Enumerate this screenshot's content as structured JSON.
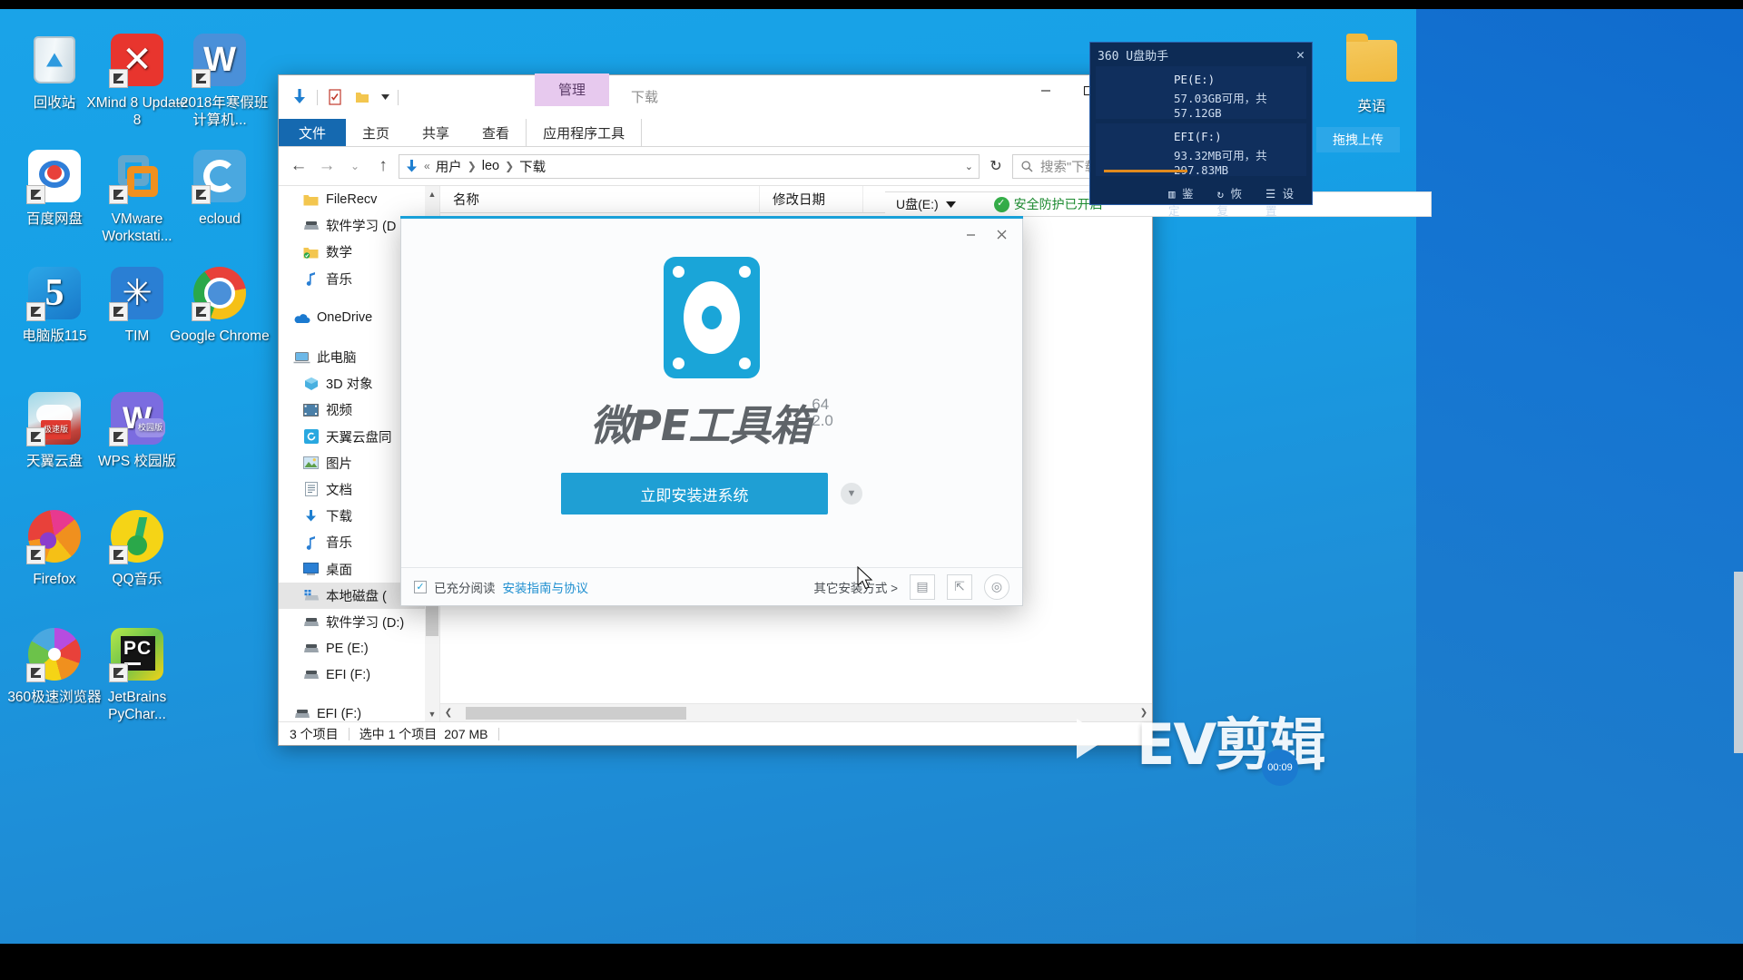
{
  "desktop": {
    "icons": [
      {
        "label": "回收站",
        "icon": "recycle-bin-icon",
        "shortcut": false,
        "col": 0,
        "row": 0
      },
      {
        "label": "XMind 8 Update 8",
        "icon": "xmind-icon",
        "shortcut": true,
        "col": 1,
        "row": 0
      },
      {
        "label": "--2018年寒假班计算机...",
        "icon": "word-doc-icon",
        "shortcut": true,
        "col": 2,
        "row": 0
      },
      {
        "label": "百度网盘",
        "icon": "baidu-netdisk-icon",
        "shortcut": true,
        "col": 0,
        "row": 1
      },
      {
        "label": "VMware Workstati...",
        "icon": "vmware-icon",
        "shortcut": true,
        "col": 1,
        "row": 1
      },
      {
        "label": "ecloud",
        "icon": "ecloud-icon",
        "shortcut": true,
        "col": 2,
        "row": 1
      },
      {
        "label": "电脑版115",
        "icon": "115-icon",
        "shortcut": true,
        "col": 0,
        "row": 2
      },
      {
        "label": "TIM",
        "icon": "tim-icon",
        "shortcut": true,
        "col": 1,
        "row": 2
      },
      {
        "label": "Google Chrome",
        "icon": "chrome-icon",
        "shortcut": true,
        "col": 2,
        "row": 2
      },
      {
        "label": "天翼云盘",
        "icon": "tianyi-cloud-icon",
        "shortcut": true,
        "col": 0,
        "row": 3,
        "badge": "极速版"
      },
      {
        "label": "WPS 校园版",
        "icon": "wps-icon",
        "shortcut": true,
        "col": 1,
        "row": 3,
        "badge": "校园版"
      },
      {
        "label": "Firefox",
        "icon": "firefox-icon",
        "shortcut": true,
        "col": 0,
        "row": 4
      },
      {
        "label": "QQ音乐",
        "icon": "qq-music-icon",
        "shortcut": true,
        "col": 1,
        "row": 4
      },
      {
        "label": "360极速浏览器",
        "icon": "360-browser-icon",
        "shortcut": true,
        "col": 0,
        "row": 5
      },
      {
        "label": "JetBrains PyChar...",
        "icon": "pycharm-icon",
        "shortcut": true,
        "col": 1,
        "row": 5
      }
    ],
    "right_icon": {
      "label": "英语",
      "icon": "folder-icon"
    }
  },
  "explorer": {
    "quick_access": {
      "download_icon": "download-arrow-icon",
      "properties_icon": "properties-icon",
      "new_folder_icon": "new-folder-icon",
      "customize_icon": "chevron-down-icon"
    },
    "context_tab_group": "管理",
    "window_title": "下载",
    "window_buttons": {
      "minimize": "minimize-icon",
      "maximize": "maximize-icon",
      "close": "close-icon"
    },
    "ribbon_tabs": [
      {
        "label": "文件",
        "active": true
      },
      {
        "label": "主页",
        "active": false
      },
      {
        "label": "共享",
        "active": false
      },
      {
        "label": "查看",
        "active": false
      },
      {
        "label": "应用程序工具",
        "active": false
      }
    ],
    "ribbon_right": {
      "collapse_icon": "chevron-down-icon",
      "help_label": "?"
    },
    "address": {
      "back_icon": "arrow-left-icon",
      "forward_icon": "arrow-right-icon",
      "recent_icon": "chevron-down-icon",
      "up_icon": "arrow-up-icon",
      "path_icon": "download-arrow-icon",
      "crumbs": [
        "用户",
        "leo",
        "下载"
      ],
      "prefix": "«",
      "dropdown_icon": "chevron-down-icon",
      "refresh_icon": "refresh-icon"
    },
    "search": {
      "placeholder": "搜索\"下载\"",
      "icon": "search-icon"
    },
    "sidebar": [
      {
        "label": "FileRecv",
        "icon": "folder-icon",
        "indent": 2
      },
      {
        "label": "软件学习 (D",
        "icon": "drive-icon",
        "indent": 2
      },
      {
        "label": "数学",
        "icon": "folder-sync-icon",
        "indent": 2
      },
      {
        "label": "音乐",
        "icon": "music-note-icon",
        "indent": 2
      },
      {
        "type": "gap"
      },
      {
        "label": "OneDrive",
        "icon": "onedrive-icon",
        "indent": 1
      },
      {
        "type": "gap"
      },
      {
        "label": "此电脑",
        "icon": "this-pc-icon",
        "indent": 1
      },
      {
        "label": "3D 对象",
        "icon": "3d-objects-icon",
        "indent": 2
      },
      {
        "label": "视频",
        "icon": "videos-icon",
        "indent": 2
      },
      {
        "label": "天翼云盘同",
        "icon": "tianyi-sync-icon",
        "indent": 2
      },
      {
        "label": "图片",
        "icon": "pictures-icon",
        "indent": 2
      },
      {
        "label": "文档",
        "icon": "documents-icon",
        "indent": 2
      },
      {
        "label": "下载",
        "icon": "downloads-icon",
        "indent": 2
      },
      {
        "label": "音乐",
        "icon": "music-note-icon",
        "indent": 2
      },
      {
        "label": "桌面",
        "icon": "desktop-icon",
        "indent": 2
      },
      {
        "label": "本地磁盘 (",
        "icon": "windows-drive-icon",
        "indent": 2,
        "selected": true
      },
      {
        "label": "软件学习 (D:)",
        "icon": "drive-icon",
        "indent": 2
      },
      {
        "label": "PE (E:)",
        "icon": "drive-icon",
        "indent": 2
      },
      {
        "label": "EFI (F:)",
        "icon": "drive-icon",
        "indent": 2
      },
      {
        "type": "gap"
      },
      {
        "label": "EFI (F:)",
        "icon": "drive-icon",
        "indent": 1
      }
    ],
    "columns": [
      {
        "label": "名称"
      },
      {
        "label": "修改日期"
      },
      {
        "label": ""
      }
    ],
    "status": {
      "item_count": "3 个项目",
      "selection": "选中 1 个项目",
      "size": "207 MB"
    }
  },
  "udisk_toolbar": {
    "drive_label": "U盘(E:)",
    "drive_caret": "chevron-down-icon",
    "protection_label": "安全防护已开启",
    "protection_icon": "shield-check-icon",
    "gear_icon": "gear-icon"
  },
  "wepe_dialog": {
    "logo_icon": "hard-disk-icon",
    "brand_cn": "微PE工具箱",
    "brand_bits": "64",
    "brand_version": "2.0",
    "install_button": "立即安装进系统",
    "more_caret_icon": "chevron-down-icon",
    "agree_checkbox_label": "已充分阅读",
    "agreement_link": "安装指南与协议",
    "other_methods": "其它安装方式 >",
    "footer_icons": [
      "usb-install-icon",
      "plug-install-icon",
      "iso-install-icon"
    ],
    "minimize_icon": "minimize-icon",
    "close_icon": "close-icon"
  },
  "u360_panel": {
    "title": "360 U盘助手",
    "close_icon": "close-icon",
    "drives": [
      {
        "name": "PE(E:)",
        "detail": "57.03GB可用，共57.12GB",
        "bar_percent": 0
      },
      {
        "name": "EFI(F:)",
        "detail": "93.32MB可用，共297.83MB",
        "bar_percent": 69
      }
    ],
    "tools": [
      {
        "label": "鉴定",
        "icon": "identify-icon"
      },
      {
        "label": "恢复",
        "icon": "restore-icon"
      },
      {
        "label": "设置",
        "icon": "settings-list-icon"
      }
    ]
  },
  "drag_upload": {
    "label": "拖拽上传"
  },
  "watermark": {
    "text": "EV剪辑",
    "timer": "00:09",
    "play_icon": "play-icon"
  },
  "colors": {
    "desktop_blue": "#16a0e6",
    "accent_blue": "#1f9fd4",
    "ribbon_file_blue": "#1569b0",
    "context_tab_purple": "#e7c9ee",
    "u360_bg": "#0d2b55",
    "status_green": "#1b8a2f"
  }
}
